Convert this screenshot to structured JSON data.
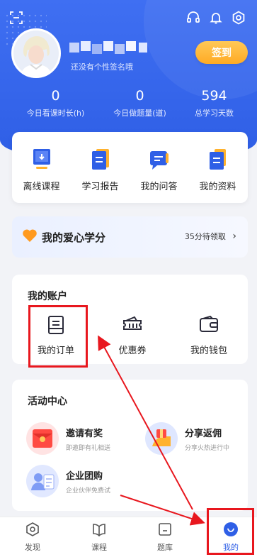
{
  "header": {
    "bio": "还没有个性签名哦",
    "checkin_label": "签到",
    "stats": [
      {
        "value": "0",
        "label": "今日看课时长(h)"
      },
      {
        "value": "0",
        "label": "今日做题量(道)"
      },
      {
        "value": "594",
        "label": "总学习天数"
      }
    ]
  },
  "tools": [
    {
      "label": "离线课程",
      "icon": "offline-course-icon"
    },
    {
      "label": "学习报告",
      "icon": "study-report-icon"
    },
    {
      "label": "我的问答",
      "icon": "qa-icon"
    },
    {
      "label": "我的资料",
      "icon": "materials-icon"
    }
  ],
  "love": {
    "title": "我的爱心学分",
    "right_text": "35分待领取",
    "chevron": "›"
  },
  "account": {
    "title": "我的账户",
    "items": [
      {
        "label": "我的订单",
        "icon": "order-icon"
      },
      {
        "label": "优惠券",
        "icon": "coupon-icon"
      },
      {
        "label": "我的钱包",
        "icon": "wallet-icon"
      }
    ]
  },
  "activity": {
    "title": "活动中心",
    "items": [
      {
        "title": "邀请有奖",
        "subtitle": "即邀即有礼相送",
        "icon": "red-envelope-icon"
      },
      {
        "title": "分享返佣",
        "subtitle": "分享火热进行中",
        "icon": "share-reward-icon"
      },
      {
        "title": "企业团购",
        "subtitle": "企业伙伴免费试",
        "icon": "enterprise-icon"
      }
    ]
  },
  "tabs": [
    {
      "label": "发现",
      "icon": "discover-icon"
    },
    {
      "label": "课程",
      "icon": "course-icon"
    },
    {
      "label": "题库",
      "icon": "question-bank-icon"
    },
    {
      "label": "我的",
      "icon": "profile-icon"
    }
  ],
  "colors": {
    "primary": "#2f5fe6",
    "checkin": "#ffb22e",
    "annotation": "#e8171e"
  }
}
